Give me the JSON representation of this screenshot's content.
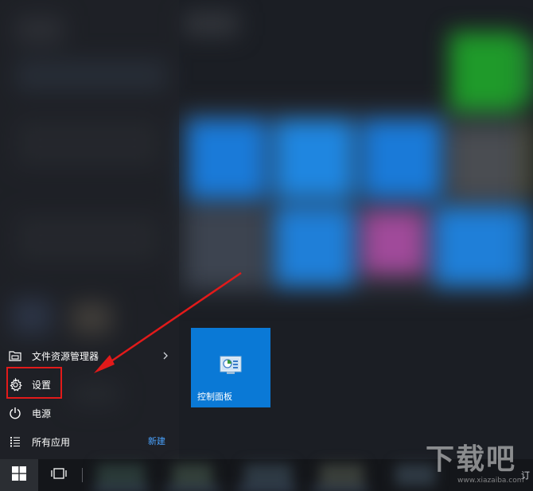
{
  "start_menu": {
    "items": [
      {
        "label": "文件资源管理器",
        "icon": "file-explorer-icon",
        "has_submenu": true
      },
      {
        "label": "设置",
        "icon": "gear-icon"
      },
      {
        "label": "电源",
        "icon": "power-icon"
      },
      {
        "label": "所有应用",
        "icon": "list-icon"
      }
    ],
    "new_badge": "新建"
  },
  "tiles": [
    {
      "label": "控制面板",
      "icon": "control-panel-icon",
      "color": "#0a79d6"
    }
  ],
  "annotation": {
    "highlight_color": "#e21a1a",
    "arrow_color": "#e21a1a"
  },
  "taskbar": {
    "start_icon": "windows-logo-icon",
    "task_view_icon": "task-view-icon",
    "tray_text": "订"
  },
  "watermark": {
    "text": "下载吧",
    "url_text": "www.xiazaiba.com"
  }
}
